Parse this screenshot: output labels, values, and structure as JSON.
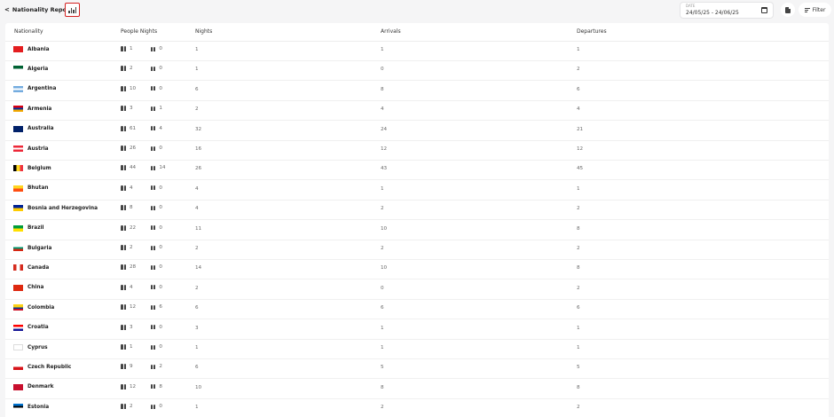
{
  "header": {
    "back_label": "Nationality Report",
    "back_chevron": "<"
  },
  "date_filter": {
    "label": "DATE",
    "range": "24/05/25 - 24/06/25"
  },
  "filter_button": {
    "label": "Filter"
  },
  "table": {
    "columns": [
      "Nationality",
      "People Nights",
      "Nights",
      "Arrivals",
      "Departures"
    ],
    "rows": [
      {
        "country": "Albania",
        "adults": "1",
        "children": "0",
        "nights": "1",
        "arrivals": "1",
        "departures": "1",
        "flag": [
          "#e41e20"
        ]
      },
      {
        "country": "Algeria",
        "adults": "2",
        "children": "0",
        "nights": "1",
        "arrivals": "0",
        "departures": "2",
        "flag": [
          "#006233",
          "#ffffff"
        ]
      },
      {
        "country": "Argentina",
        "adults": "10",
        "children": "0",
        "nights": "6",
        "arrivals": "8",
        "departures": "6",
        "flag": [
          "#74acdf",
          "#ffffff",
          "#74acdf"
        ]
      },
      {
        "country": "Armenia",
        "adults": "3",
        "children": "1",
        "nights": "2",
        "arrivals": "4",
        "departures": "4",
        "flag": [
          "#d90012",
          "#0033a0",
          "#f2a800"
        ]
      },
      {
        "country": "Australia",
        "adults": "61",
        "children": "4",
        "nights": "32",
        "arrivals": "24",
        "departures": "21",
        "flag": [
          "#012169"
        ]
      },
      {
        "country": "Austria",
        "adults": "26",
        "children": "0",
        "nights": "16",
        "arrivals": "12",
        "departures": "12",
        "flag": [
          "#ed2939",
          "#ffffff",
          "#ed2939"
        ]
      },
      {
        "country": "Belgium",
        "adults": "44",
        "children": "14",
        "nights": "26",
        "arrivals": "43",
        "departures": "45",
        "flag": [
          "#000000",
          "#fdda24",
          "#ef3340"
        ],
        "vertical": true
      },
      {
        "country": "Bhutan",
        "adults": "4",
        "children": "0",
        "nights": "4",
        "arrivals": "1",
        "departures": "1",
        "flag": [
          "#ffd520",
          "#ff4e12"
        ]
      },
      {
        "country": "Bosnia and Herzegovina",
        "adults": "8",
        "children": "0",
        "nights": "4",
        "arrivals": "2",
        "departures": "2",
        "flag": [
          "#002395",
          "#fecb00"
        ]
      },
      {
        "country": "Brazil",
        "adults": "22",
        "children": "0",
        "nights": "11",
        "arrivals": "10",
        "departures": "8",
        "flag": [
          "#009c3b",
          "#ffdf00"
        ]
      },
      {
        "country": "Bulgaria",
        "adults": "2",
        "children": "0",
        "nights": "2",
        "arrivals": "2",
        "departures": "2",
        "flag": [
          "#ffffff",
          "#00966e",
          "#d62612"
        ]
      },
      {
        "country": "Canada",
        "adults": "28",
        "children": "0",
        "nights": "14",
        "arrivals": "10",
        "departures": "8",
        "flag": [
          "#d52b1e",
          "#ffffff",
          "#d52b1e"
        ],
        "vertical": true
      },
      {
        "country": "China",
        "adults": "4",
        "children": "0",
        "nights": "2",
        "arrivals": "0",
        "departures": "2",
        "flag": [
          "#de2910"
        ]
      },
      {
        "country": "Colombia",
        "adults": "12",
        "children": "6",
        "nights": "6",
        "arrivals": "6",
        "departures": "6",
        "flag": [
          "#fcd116",
          "#fcd116",
          "#003893",
          "#ce1126"
        ]
      },
      {
        "country": "Croatia",
        "adults": "3",
        "children": "0",
        "nights": "3",
        "arrivals": "1",
        "departures": "1",
        "flag": [
          "#ff0000",
          "#ffffff",
          "#171796"
        ]
      },
      {
        "country": "Cyprus",
        "adults": "1",
        "children": "0",
        "nights": "1",
        "arrivals": "1",
        "departures": "1",
        "flag": [
          "#ffffff"
        ]
      },
      {
        "country": "Czech Republic",
        "adults": "9",
        "children": "2",
        "nights": "6",
        "arrivals": "5",
        "departures": "5",
        "flag": [
          "#ffffff",
          "#d7141a"
        ]
      },
      {
        "country": "Denmark",
        "adults": "12",
        "children": "8",
        "nights": "10",
        "arrivals": "8",
        "departures": "8",
        "flag": [
          "#c8102e"
        ]
      },
      {
        "country": "Estonia",
        "adults": "2",
        "children": "0",
        "nights": "1",
        "arrivals": "2",
        "departures": "2",
        "flag": [
          "#0072ce",
          "#000000",
          "#ffffff"
        ]
      }
    ]
  },
  "colors": {
    "highlight_border": "#d32020",
    "page_bg": "#f5f5f6"
  }
}
